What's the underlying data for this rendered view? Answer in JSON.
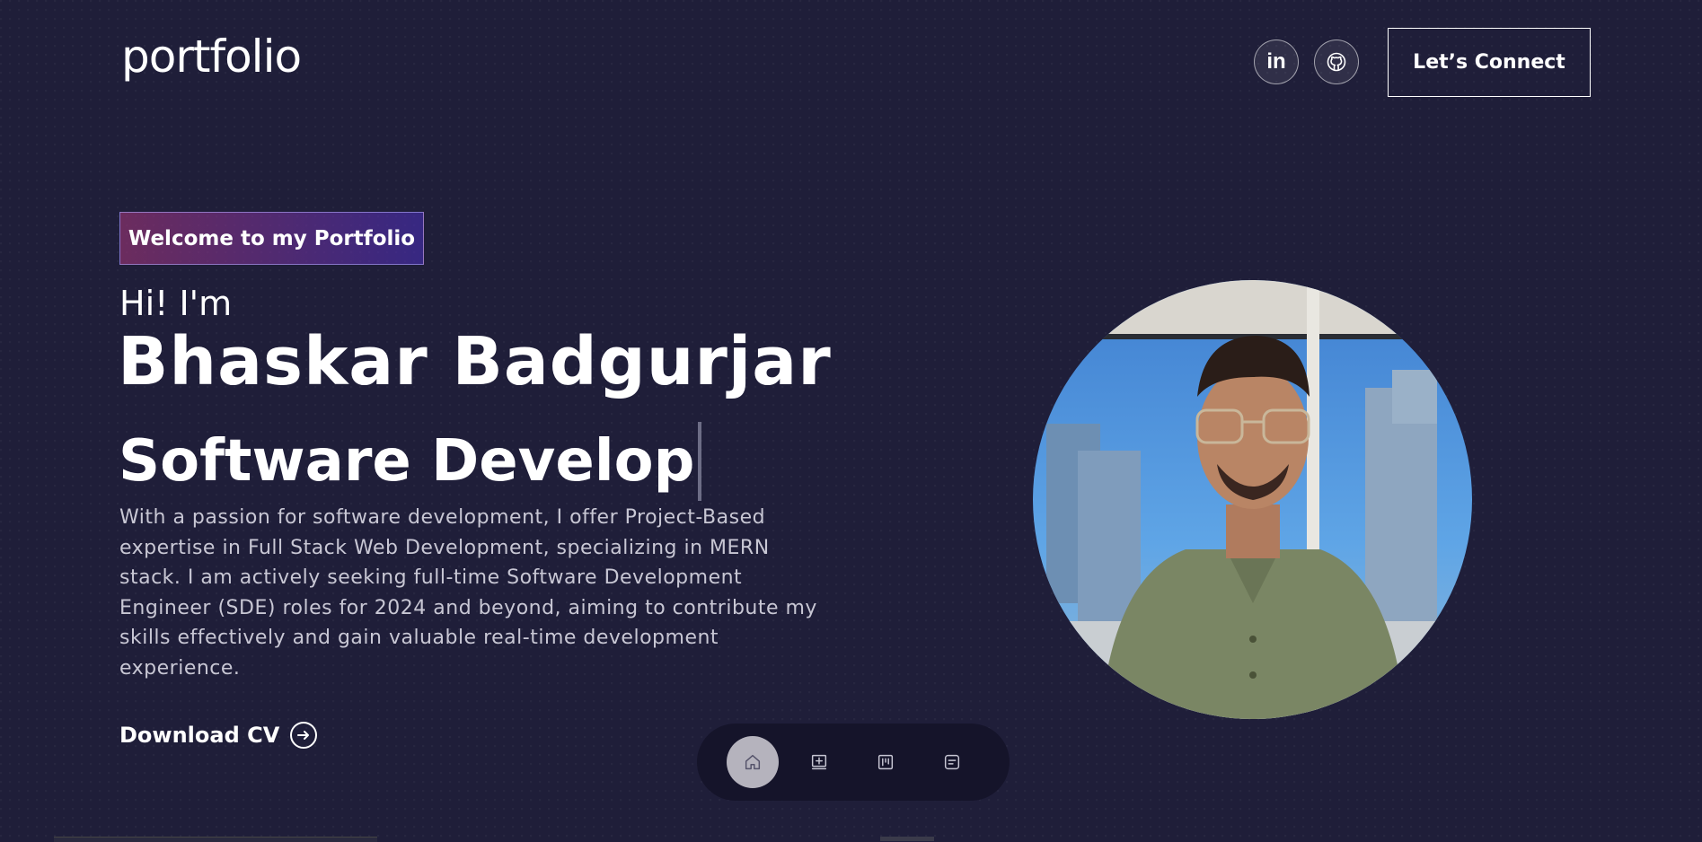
{
  "header": {
    "logo": "portfolio",
    "social": [
      "linkedin-icon",
      "github-icon"
    ],
    "linkedin_text": "in",
    "cta_label": "Let’s Connect"
  },
  "hero": {
    "tagline": "Welcome to my Portfolio",
    "greeting": "Hi! I'm",
    "name": "Bhaskar Badgurjar",
    "role_typed": "Software Develop",
    "description": "With a passion for software development, I offer Project-Based expertise in Full Stack Web Development, specializing in MERN stack. I am actively seeking full-time Software Development Engineer (SDE) roles for 2024 and beyond, aiming to contribute my skills effectively and gain valuable real-time development experience.",
    "download_label": "Download CV"
  },
  "dock": {
    "items": [
      "home-icon",
      "add-book-icon",
      "projects-icon",
      "notes-icon"
    ],
    "active": "home-icon"
  },
  "colors": {
    "background": "#1f1e39",
    "dock": "#15142a",
    "text_muted": "#c8c7d4"
  }
}
